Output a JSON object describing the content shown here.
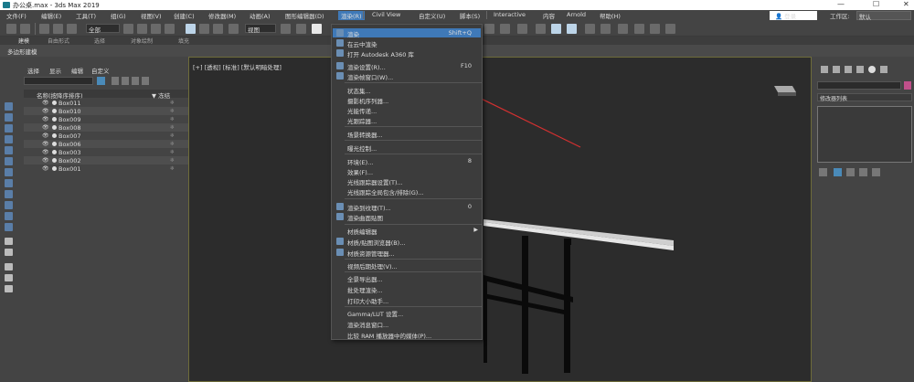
{
  "titlebar": {
    "title": "办公桌.max - 3ds Max 2019",
    "minimize": "—",
    "maximize": "☐",
    "close": "✕"
  },
  "menubar": {
    "items": [
      "文件(F)",
      "编辑(E)",
      "工具(T)",
      "组(G)",
      "视图(V)",
      "创建(C)",
      "修改器(M)",
      "动画(A)",
      "图形编辑器(D)",
      "渲染(R)",
      "Civil View",
      "自定义(U)",
      "脚本(S)",
      "Interactive",
      "内容",
      "Arnold",
      "帮助(H)"
    ],
    "login": "登录",
    "workspace_label": "工作区:",
    "workspace_value": "默认"
  },
  "toolbar": {
    "filter_all": "全部",
    "view_ref": "视图"
  },
  "ribbon": {
    "tabs": [
      "建模",
      "自由形式",
      "选择",
      "对象绘制",
      "填充"
    ],
    "sub": "多边形建模"
  },
  "scene_explorer": {
    "tabs": [
      "选择",
      "显示",
      "编辑",
      "自定义"
    ],
    "col_name": "名称(按降序排序)",
    "col_freeze": "▼ 冻结",
    "rows": [
      "Box011",
      "Box010",
      "Box009",
      "Box008",
      "Box007",
      "Box006",
      "Box003",
      "Box002",
      "Box001"
    ]
  },
  "viewport": {
    "label": "[+] [透视] [标准] [默认明暗处理]"
  },
  "cmdpanel": {
    "modifier_list": "修改器列表"
  },
  "menu": {
    "items": [
      {
        "label": "渲染",
        "shortcut": "Shift+Q",
        "icon": true
      },
      {
        "label": "在云中渲染",
        "shortcut": "",
        "icon": true
      },
      {
        "label": "打开 Autodesk A360 库",
        "shortcut": "",
        "icon": true
      },
      {
        "label": "渲染设置(R)...",
        "shortcut": "F10",
        "icon": true
      },
      {
        "label": "渲染帧窗口(W)...",
        "shortcut": "",
        "icon": true
      },
      {
        "label": "状态集...",
        "shortcut": "",
        "icon": false
      },
      {
        "label": "摄影机序列器...",
        "shortcut": "",
        "icon": false
      },
      {
        "label": "光能传递...",
        "shortcut": "",
        "icon": false
      },
      {
        "label": "光跟踪器...",
        "shortcut": "",
        "icon": false
      },
      {
        "label": "场景转换器...",
        "shortcut": "",
        "icon": false
      },
      {
        "label": "曝光控制...",
        "shortcut": "",
        "icon": false
      },
      {
        "label": "环境(E)...",
        "shortcut": "8",
        "icon": false
      },
      {
        "label": "效果(F)...",
        "shortcut": "",
        "icon": false
      },
      {
        "label": "光线跟踪器设置(T)...",
        "shortcut": "",
        "icon": false
      },
      {
        "label": "光线跟踪全局包含/排除(G)...",
        "shortcut": "",
        "icon": false
      },
      {
        "label": "渲染到纹理(T)...",
        "shortcut": "0",
        "icon": true
      },
      {
        "label": "渲染曲面贴图",
        "shortcut": "",
        "icon": true
      },
      {
        "label": "材质编辑器",
        "shortcut": "",
        "icon": false
      },
      {
        "label": "材质/贴图浏览器(B)...",
        "shortcut": "",
        "icon": true
      },
      {
        "label": "材质资源管理器...",
        "shortcut": "",
        "icon": true
      },
      {
        "label": "视频后期处理(V)...",
        "shortcut": "",
        "icon": false
      },
      {
        "label": "全景导出器...",
        "shortcut": "",
        "icon": false
      },
      {
        "label": "批处理渲染...",
        "shortcut": "",
        "icon": false
      },
      {
        "label": "打印大小助手...",
        "shortcut": "",
        "icon": false
      },
      {
        "label": "Gamma/LUT 设置...",
        "shortcut": "",
        "icon": false
      },
      {
        "label": "渲染消息窗口...",
        "shortcut": "",
        "icon": false
      },
      {
        "label": "比较 RAM 播放器中的媒体(P)...",
        "shortcut": "",
        "icon": false
      }
    ]
  }
}
